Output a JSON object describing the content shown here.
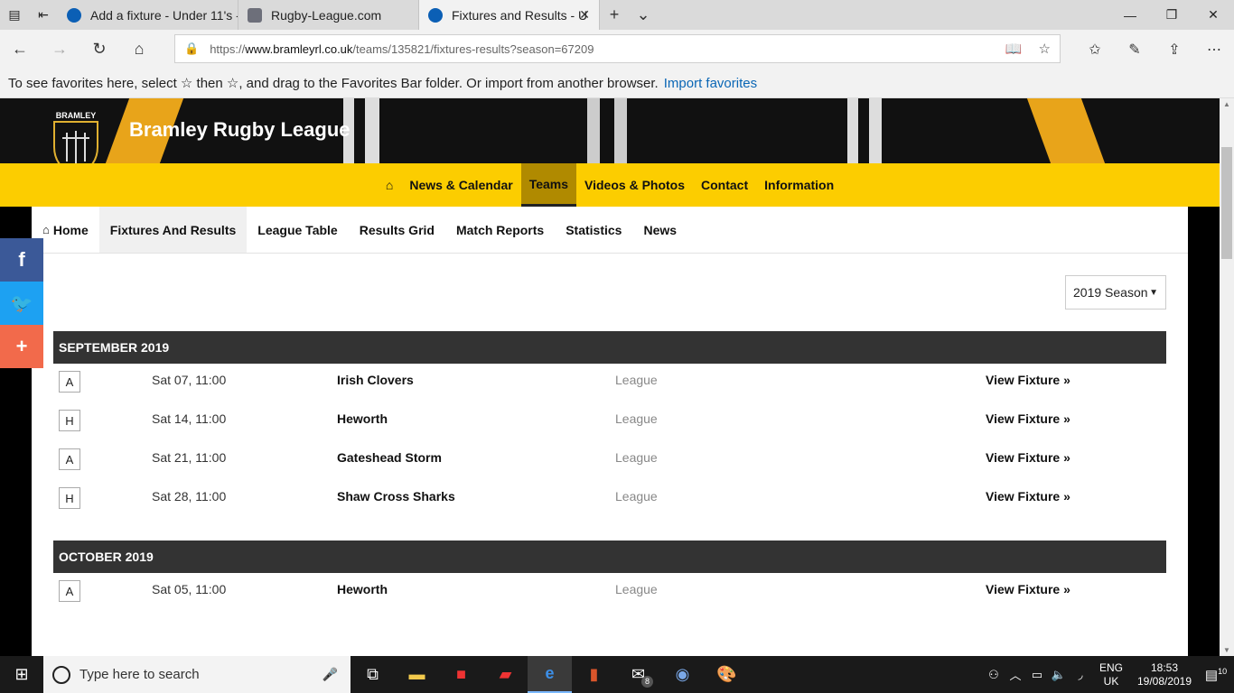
{
  "browser": {
    "tabs": [
      {
        "title": "Add a fixture - Under 11's -",
        "active": false
      },
      {
        "title": "Rugby-League.com",
        "active": false
      },
      {
        "title": "Fixtures and Results - U",
        "active": true
      }
    ],
    "url_prefix": "https://",
    "url_host": "www.bramleyrl.co.uk",
    "url_path": "/teams/135821/fixtures-results?season=67209",
    "favbar_text": "To see favorites here, select  ☆  then ☆, and drag to the Favorites Bar folder. Or import from another browser.",
    "favbar_link": "Import favorites"
  },
  "site": {
    "title": "Bramley Rugby League",
    "logo_text": "BRAMLEY",
    "nav": [
      "News & Calendar",
      "Teams",
      "Videos & Photos",
      "Contact",
      "Information"
    ],
    "nav_active": "Teams",
    "subnav": [
      "Home",
      "Fixtures And Results",
      "League Table",
      "Results Grid",
      "Match Reports",
      "Statistics",
      "News"
    ],
    "subnav_active": "Fixtures And Results",
    "season_selected": "2019 Season"
  },
  "months": [
    {
      "name": "SEPTEMBER 2019",
      "fixtures": [
        {
          "ha": "A",
          "date": "Sat 07, 11:00",
          "opponent": "Irish Clovers",
          "competition": "League",
          "link": "View Fixture »"
        },
        {
          "ha": "H",
          "date": "Sat 14, 11:00",
          "opponent": "Heworth",
          "competition": "League",
          "link": "View Fixture »"
        },
        {
          "ha": "A",
          "date": "Sat 21, 11:00",
          "opponent": "Gateshead Storm",
          "competition": "League",
          "link": "View Fixture »"
        },
        {
          "ha": "H",
          "date": "Sat 28, 11:00",
          "opponent": "Shaw Cross Sharks",
          "competition": "League",
          "link": "View Fixture »"
        }
      ]
    },
    {
      "name": "OCTOBER 2019",
      "fixtures": [
        {
          "ha": "A",
          "date": "Sat 05, 11:00",
          "opponent": "Heworth",
          "competition": "League",
          "link": "View Fixture »"
        }
      ]
    }
  ],
  "social": [
    {
      "icon": "facebook-icon",
      "glyph": "f",
      "color": "#3b5998"
    },
    {
      "icon": "twitter-icon",
      "glyph": "t",
      "color": "#1da1f2"
    },
    {
      "icon": "plus-icon",
      "glyph": "+",
      "color": "#f26a4b"
    }
  ],
  "taskbar": {
    "search_placeholder": "Type here to search",
    "lang_1": "ENG",
    "lang_2": "UK",
    "time": "18:53",
    "date": "19/08/2019",
    "notification_count": "10",
    "mail_badge": "8"
  }
}
